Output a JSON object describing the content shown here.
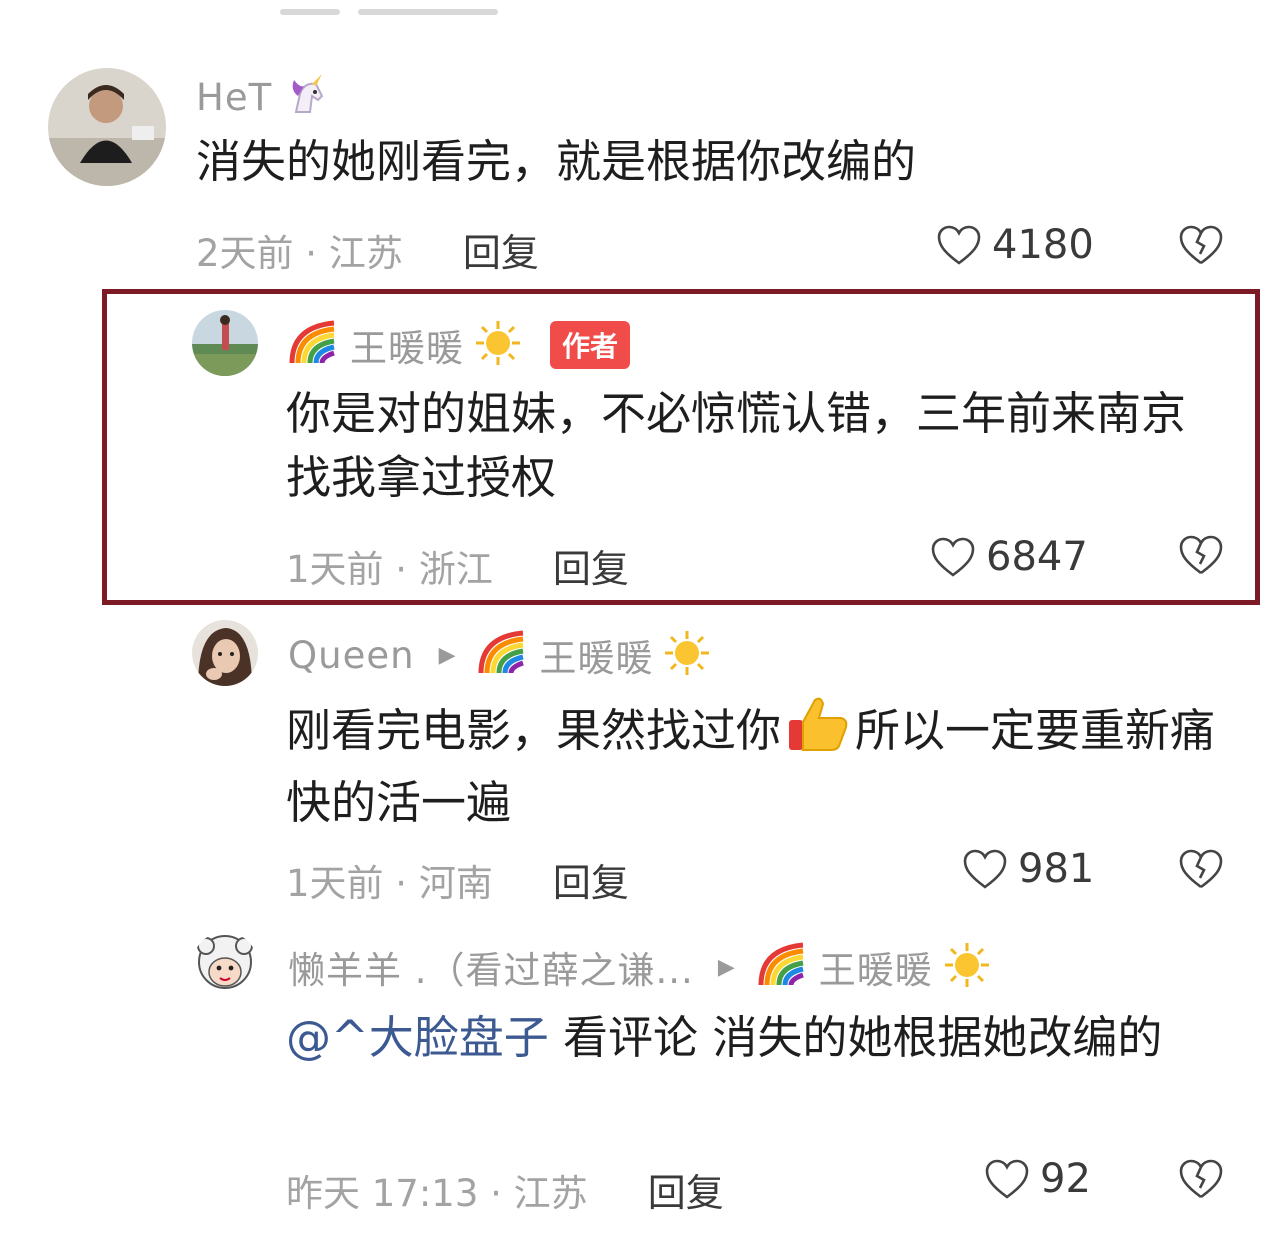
{
  "comments": [
    {
      "user": "HeT",
      "text": "消失的她刚看完，就是根据你改编的",
      "meta": "2天前 · 江苏",
      "reply": "回复",
      "likes": "4180"
    },
    {
      "user": "王暖暖",
      "badge": "作者",
      "text": "你是对的姐妹，不必惊慌认错，三年前来南京找我拿过授权",
      "meta": "1天前 · 浙江",
      "reply": "回复",
      "likes": "6847"
    },
    {
      "user": "Queen",
      "reply_to": "王暖暖",
      "text_part1": "刚看完电影，果然找过你",
      "text_part2": "所以一定要重新痛快的活一遍",
      "meta": "1天前 · 河南",
      "reply": "回复",
      "likes": "981"
    },
    {
      "user": "懒羊羊 .（看过薛之谦...",
      "reply_to": "王暖暖",
      "mention": "@^大脸盘子",
      "text": " 看评论  消失的她根据她改编的",
      "meta": "昨天 17:13 · 江苏",
      "reply": "回复",
      "likes": "92"
    }
  ],
  "icons": [
    "unicorn-icon",
    "rainbow-icon",
    "sun-icon",
    "thumbs-up-icon",
    "heart-icon",
    "broken-heart-icon",
    "play-arrow-icon"
  ],
  "colors": {
    "highlight_border": "#7c1b25",
    "badge": "#f04c4a",
    "mention": "#3c5a91"
  }
}
